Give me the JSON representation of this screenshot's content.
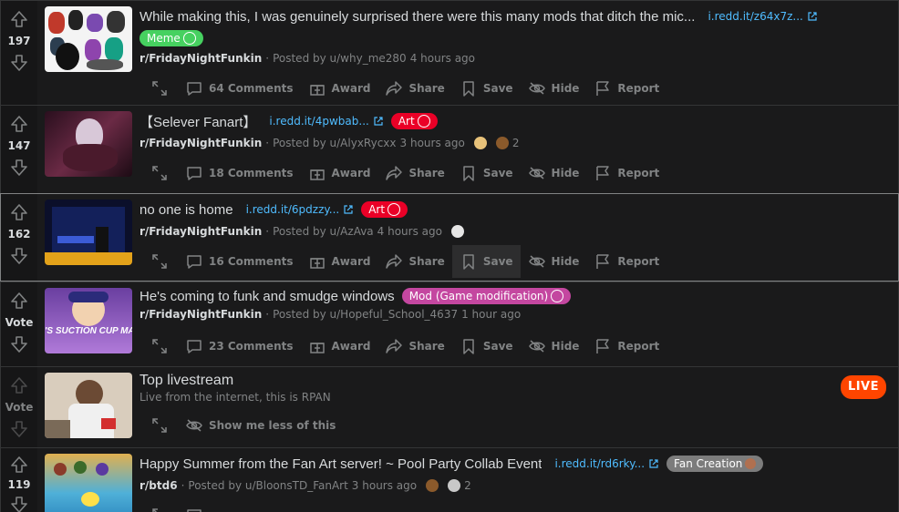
{
  "posts": [
    {
      "score": "197",
      "title": "While making this, I was genuinely surprised there were this many mods that ditch the mic...",
      "domain": "i.redd.it/z64x7z...",
      "flair": "Meme",
      "subreddit": "r/FridayNightFunkin",
      "posted_by": "Posted by u/why_me280",
      "time": "4 hours ago",
      "comments": "64 Comments"
    },
    {
      "score": "147",
      "title": "【Selever Fanart】",
      "domain": "i.redd.it/4pwbab...",
      "flair": "Art",
      "subreddit": "r/FridayNightFunkin",
      "posted_by": "Posted by u/AlyxRycxx",
      "time": "3 hours ago",
      "award_count": "2",
      "comments": "18 Comments"
    },
    {
      "score": "162",
      "title": "no one is home",
      "domain": "i.redd.it/6pdzzy...",
      "flair": "Art",
      "subreddit": "r/FridayNightFunkin",
      "posted_by": "Posted by u/AzAva",
      "time": "4 hours ago",
      "comments": "16 Comments"
    },
    {
      "score": "Vote",
      "title": "He's coming to funk and smudge windows",
      "flair": "Mod (Game modification)",
      "subreddit": "r/FridayNightFunkin",
      "posted_by": "Posted by u/Hopeful_School_4637",
      "time": "1 hour ago",
      "comments": "23 Comments",
      "thumb_text": "'S SUCTION CUP MAI"
    },
    {
      "score": "Vote",
      "title": "Top livestream",
      "subtitle": "Live from the internet, this is RPAN",
      "live_badge": "LIVE",
      "show_less": "Show me less of this"
    },
    {
      "score": "119",
      "title": "Happy Summer from the Fan Art server! ~ Pool Party Collab Event",
      "domain": "i.redd.it/rd6rky...",
      "flair": "Fan Creation",
      "subreddit": "r/btd6",
      "posted_by": "Posted by u/BloonsTD_FanArt",
      "time": "3 hours ago",
      "award_count": "2"
    }
  ],
  "actions": {
    "award": "Award",
    "share": "Share",
    "save": "Save",
    "hide": "Hide",
    "report": "Report"
  },
  "colors": {
    "background": "#1a1a1b",
    "vote_column": "#161617",
    "link": "#4fbcff",
    "flair_meme": "#46d160",
    "flair_art": "#ea0027",
    "flair_mod": "#c447a0",
    "flair_fan": "#7c7c7c",
    "live": "#ff4500"
  }
}
